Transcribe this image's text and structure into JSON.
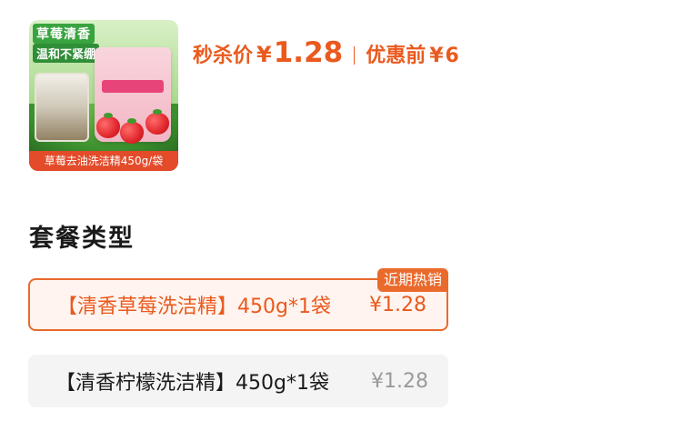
{
  "product": {
    "image_title": "草莓清香",
    "image_subtitle": "温和不紧绷",
    "image_caption": "草莓去油洗洁精450g/袋"
  },
  "price": {
    "seckill_label": "秒杀价",
    "currency": "¥",
    "seckill_value": "1.28",
    "original_label": "优惠前",
    "original_value": "6"
  },
  "package": {
    "section_title": "套餐类型",
    "options": [
      {
        "name": "【清香草莓洗洁精】450g*1袋",
        "price": "¥1.28",
        "badge": "近期热销",
        "selected": true
      },
      {
        "name": "【清香柠檬洗洁精】450g*1袋",
        "price": "¥1.28",
        "selected": false
      }
    ]
  },
  "colors": {
    "accent": "#ea5a1e",
    "selected_border": "#ea6a2c",
    "selected_bg": "#fff4ef",
    "option_bg": "#f4f4f5",
    "muted_price": "#9a9a9a"
  }
}
